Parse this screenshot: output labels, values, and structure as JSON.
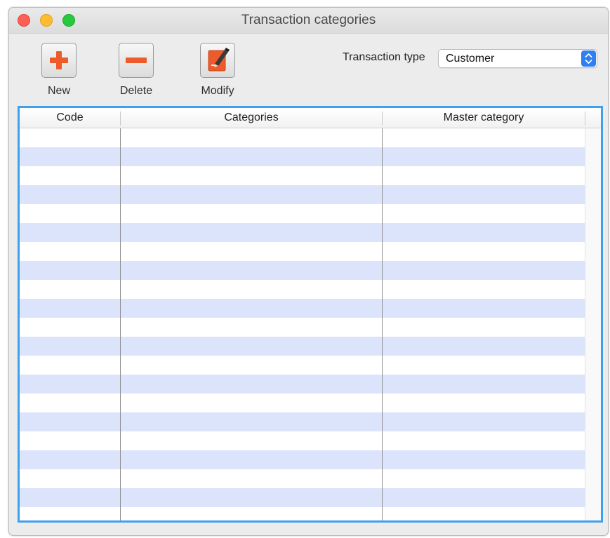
{
  "window": {
    "title": "Transaction categories"
  },
  "toolbar": {
    "new_label": "New",
    "delete_label": "Delete",
    "modify_label": "Modify",
    "new_icon": "plus-icon",
    "delete_icon": "minus-icon",
    "modify_icon": "edit-document-icon"
  },
  "filter": {
    "label": "Transaction type",
    "selected": "Customer"
  },
  "table": {
    "columns": [
      "Code",
      "Categories",
      "Master category"
    ],
    "rows": []
  },
  "colors": {
    "accent": "#3ea1ee",
    "icon_orange": "#ee5b2a",
    "row_stripe": "#dbe4fb",
    "select_stepper": "#2f7ff0"
  }
}
